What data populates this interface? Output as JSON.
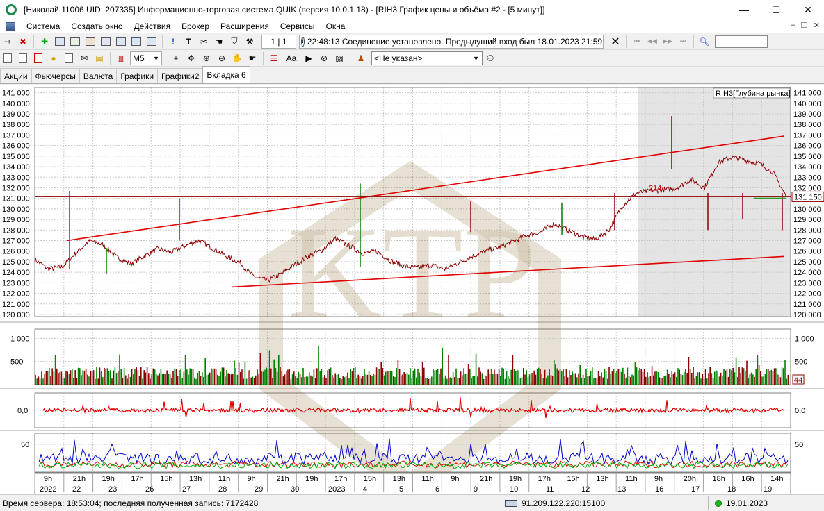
{
  "window": {
    "title": "[Николай 11006 UID: 207335] Информационно-торговая система QUIK (версия 10.0.1.18) - [RIH3 График цены и объёма #2 - [5 минут]]",
    "controls": {
      "minimize": "—",
      "maximize": "☐",
      "close": "✕"
    }
  },
  "menu": {
    "items": [
      "Система",
      "Создать окно",
      "Действия",
      "Брокер",
      "Расширения",
      "Сервисы",
      "Окна"
    ],
    "mdi": {
      "minimize": "–",
      "restore": "❐",
      "close": "✕"
    }
  },
  "toolbar": {
    "pager": "1 | 1",
    "status_message": "22:48:13  Соединение установлено. Предыдущий вход был 18.01.2023 21:59:07",
    "interval": "M5",
    "client": "<Не указан>",
    "font_label": "Aa"
  },
  "tabs": [
    "Акции",
    "Фьючерсы",
    "Валюта",
    "Графики",
    "Графики2",
    "Вкладка 6"
  ],
  "chart": {
    "legend_label": "RIH3[Глубина рынка]",
    "last_price_label": "131 150",
    "level_label": "214",
    "volume_last_label": "44",
    "price_ticks": [
      "141 000",
      "140 000",
      "139 000",
      "138 000",
      "137 000",
      "136 000",
      "135 000",
      "134 000",
      "133 000",
      "132 000",
      "131 000",
      "130 000",
      "129 000",
      "128 000",
      "127 000",
      "126 000",
      "125 000",
      "124 000",
      "123 000",
      "122 000",
      "121 000",
      "120 000"
    ],
    "volume_ticks": [
      "1 000",
      "500"
    ],
    "osc_ticks": [
      "0,0"
    ],
    "rsi_ticks": [
      "50"
    ],
    "time_labels": [
      "9h",
      "21h",
      "19h",
      "17h",
      "15h",
      "13h",
      "11h",
      "9h",
      "21h",
      "19h",
      "17h",
      "15h",
      "13h",
      "11h",
      "9h",
      "21h",
      "19h",
      "17h",
      "15h",
      "13h",
      "11h",
      "9h",
      "20h",
      "18h",
      "16h",
      "14h"
    ],
    "date_labels": [
      "2022",
      "22",
      "23",
      "26",
      "27",
      "28",
      "29",
      "30",
      "2023",
      "4",
      "5",
      "6",
      "9",
      "10",
      "11",
      "12",
      "13",
      "16",
      "17",
      "18",
      "19"
    ],
    "watermark": "KTP",
    "colors": {
      "price_line": "#8b0000",
      "trend_line": "#e00000",
      "volume_up": "#008000",
      "volume_down": "#8b0000",
      "rsi_blue": "#0000c8",
      "rsi_red": "#e00000",
      "rsi_green": "#00b000"
    }
  },
  "chart_data": {
    "type": "line",
    "title": "RIH3 График цены и объёма #2 - [5 минут]",
    "y_ticks": [
      "120 000",
      "121 000",
      "122 000",
      "123 000",
      "124 000",
      "125 000",
      "126 000",
      "127 000",
      "128 000",
      "129 000",
      "130 000",
      "131 000",
      "132 000",
      "133 000",
      "134 000",
      "135 000",
      "136 000",
      "137 000",
      "138 000",
      "139 000",
      "140 000",
      "141 000"
    ],
    "ylim": [
      119800,
      141500
    ],
    "x_dates": [
      "2022",
      "22",
      "23",
      "26",
      "27",
      "28",
      "29",
      "30",
      "2023",
      "4",
      "5",
      "6",
      "9",
      "10",
      "11",
      "12",
      "13",
      "16",
      "17",
      "18",
      "19"
    ],
    "series": [
      {
        "values": [
          125200,
          124300,
          124500,
          125800,
          127000,
          126600,
          125400,
          124800,
          125500,
          126200,
          125900,
          126500,
          127000,
          126300,
          125500,
          124900,
          123600,
          123200,
          123800,
          124700,
          125500,
          126100,
          127200,
          126500,
          125800,
          126000,
          125100,
          124600,
          124400,
          124700,
          124300,
          124900,
          125500,
          126000,
          126400,
          126900,
          127500,
          127800,
          128600,
          128000,
          127400,
          127100,
          128000,
          130300,
          131500,
          131700,
          131800,
          132000,
          132800,
          132000,
          134400,
          134900,
          134600,
          134300,
          133500,
          131150
        ]
      }
    ],
    "last_price": 131150,
    "grid": true
  },
  "statusbar": {
    "server_time": "Время сервера: 18:53:04; последняя полученная запись: 7172428",
    "connection": "91.209.122.220:15100",
    "date": "19.01.2023"
  }
}
